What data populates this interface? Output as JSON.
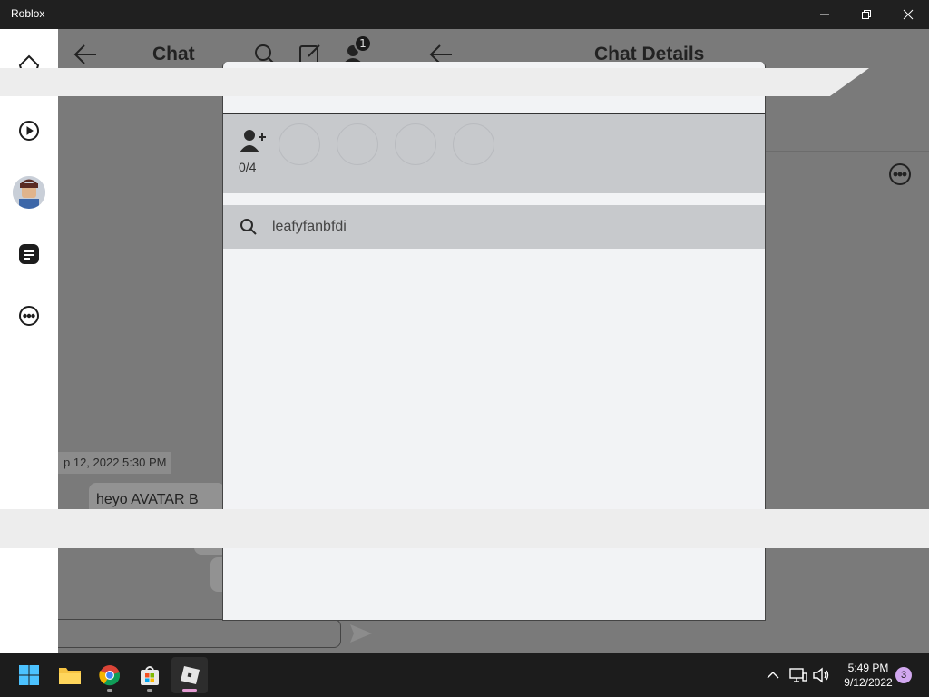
{
  "window": {
    "title": "Roblox"
  },
  "chat_pane": {
    "title": "Chat",
    "notification_count": "1",
    "date_separator": "p 12, 2022 5:30 PM",
    "message_preview": "heyo AVATAR B"
  },
  "details_pane": {
    "title": "Chat Details"
  },
  "modal": {
    "selected_count": "0/4",
    "search_value": "leafyfanbfdi"
  },
  "taskbar": {
    "time": "5:49 PM",
    "date": "9/12/2022",
    "notifications": "3"
  },
  "colors": {
    "accent_indicator": "#e39bd2",
    "notification_badge": "#d2a8f0"
  }
}
